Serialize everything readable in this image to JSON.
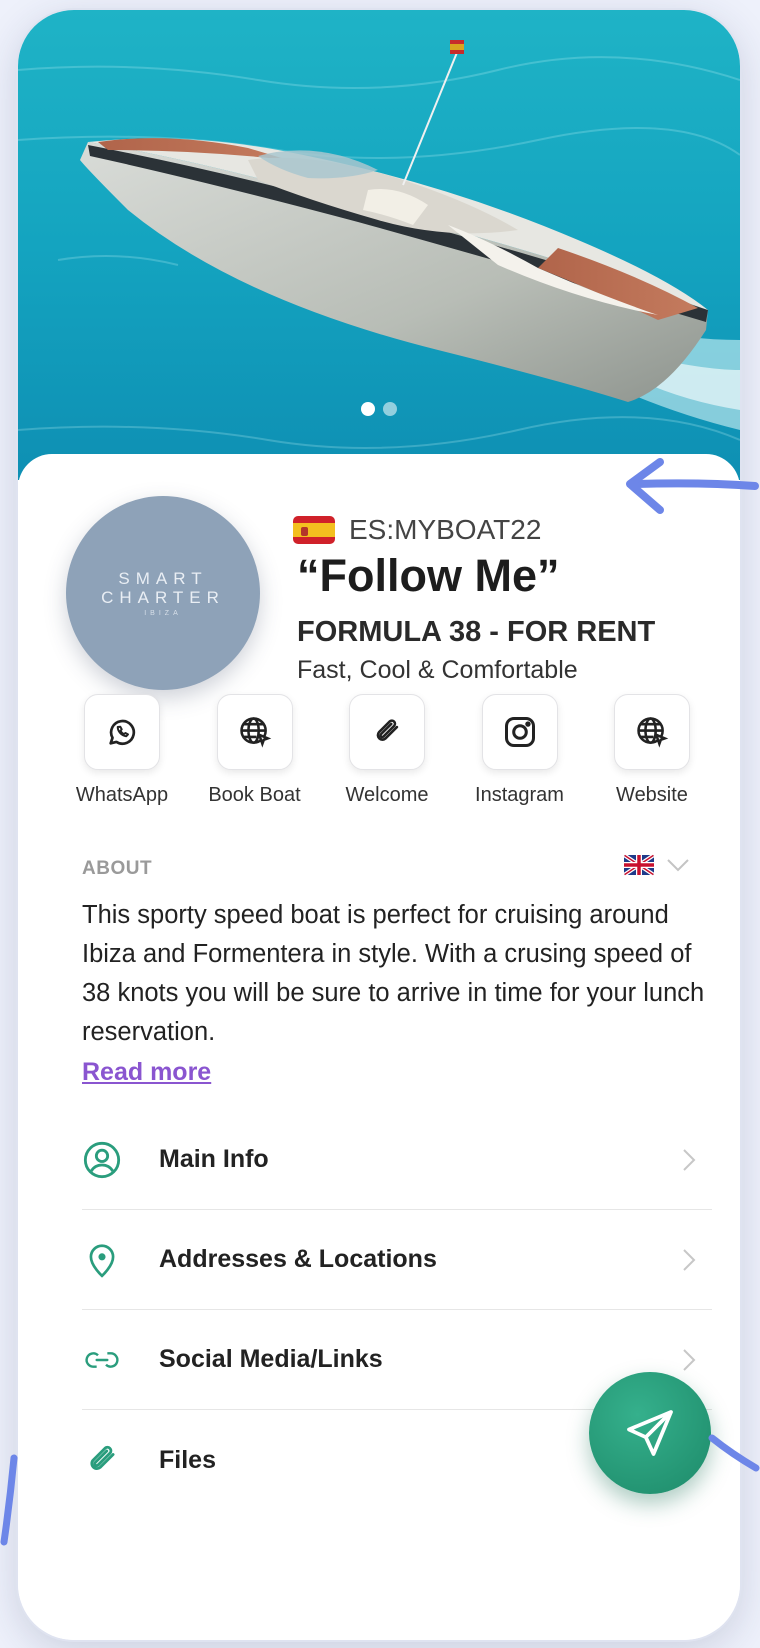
{
  "colors": {
    "accent": "#2a9d7d",
    "link": "#8a55d0",
    "annotation": "#6d86e8",
    "logo_bg": "#8ea2b8"
  },
  "hero": {
    "slide_count": 2,
    "active_slide": 1
  },
  "listing": {
    "logo": {
      "line1": "SMART",
      "line2": "CHARTER",
      "line3": "IBIZA"
    },
    "flag_icon": "spain-flag-icon",
    "registration": "ES:MYBOAT22",
    "name": "“Follow Me”",
    "model": "FORMULA 38 - FOR RENT",
    "tagline": "Fast, Cool & Comfortable"
  },
  "actions": [
    {
      "label": "WhatsApp",
      "icon": "whatsapp-icon"
    },
    {
      "label": "Book Boat",
      "icon": "globe-icon"
    },
    {
      "label": "Welcome",
      "icon": "paperclip-icon"
    },
    {
      "label": "Instagram",
      "icon": "instagram-icon"
    },
    {
      "label": "Website",
      "icon": "globe-icon"
    }
  ],
  "about": {
    "label": "ABOUT",
    "language_icon": "uk-flag-icon",
    "text": "This sporty speed boat is perfect for cruising around Ibiza and Formentera in style. With a crusing speed of 38 knots you will be sure to arrive in time for your lunch reservation.",
    "read_more": "Read more"
  },
  "menu": [
    {
      "label": "Main Info",
      "icon": "user-circle-icon"
    },
    {
      "label": "Addresses & Locations",
      "icon": "location-pin-icon"
    },
    {
      "label": "Social Media/Links",
      "icon": "link-icon"
    },
    {
      "label": "Files",
      "icon": "paperclip-icon"
    }
  ],
  "fab": {
    "icon": "send-icon"
  }
}
